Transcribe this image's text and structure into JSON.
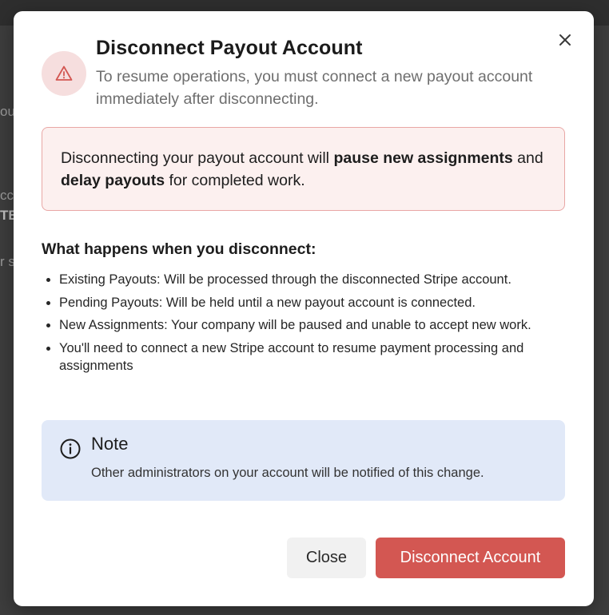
{
  "background": {
    "fragments": [
      "ou",
      "cc",
      "TE",
      "r s"
    ]
  },
  "dialog": {
    "title": "Disconnect Payout Account",
    "subtitle": "To resume operations, you must connect a new payout account immediately after disconnecting.",
    "close_icon": "close-icon",
    "warning_icon": "warning-triangle-icon",
    "alert": {
      "prefix": "Disconnecting your payout account will ",
      "bold1": "pause new assignments",
      "middle": " and ",
      "bold2": "delay payouts",
      "suffix": " for completed work."
    },
    "section_heading": "What happens when you disconnect:",
    "bullets": [
      "Existing Payouts: Will be processed through the disconnected Stripe account.",
      "Pending Payouts: Will be held until a new payout account is connected.",
      "New Assignments: Your company will be paused and unable to accept new work.",
      "You'll need to connect a new Stripe account to resume payment processing and assignments"
    ],
    "note": {
      "icon": "info-icon",
      "title": "Note",
      "text": "Other administrators on your account will be notified of this change."
    },
    "buttons": {
      "close_label": "Close",
      "disconnect_label": "Disconnect Account"
    }
  },
  "colors": {
    "danger": "#d35752",
    "alert_bg": "#fcf0ef",
    "alert_border": "#e9a7a5",
    "note_bg": "#e1e9f8",
    "backdrop": "#3d3d3d"
  }
}
